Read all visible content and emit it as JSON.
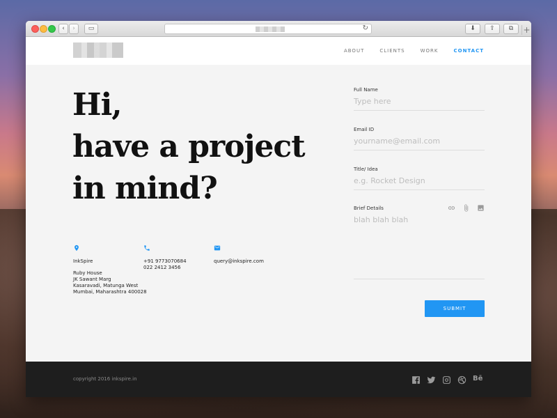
{
  "nav": {
    "about": "ABOUT",
    "clients": "CLIENTS",
    "work": "WORK",
    "contact": "CONTACT"
  },
  "hero": {
    "line1": "Hi,",
    "line2": "have a project",
    "line3": "in mind?"
  },
  "contact": {
    "company": "InkSpire",
    "address_lines": [
      "Ruby House",
      "JK Sawant Marg",
      "Kasaravadi, Matunga West",
      "Mumbai, Maharashtra 400028"
    ],
    "phone1": "+91 9773070684",
    "phone2": "022 2412 3456",
    "email": "query@inkspire.com"
  },
  "form": {
    "full_name_label": "Full Name",
    "full_name_placeholder": "Type here",
    "email_label": "Email ID",
    "email_placeholder": "yourname@email.com",
    "title_label": "Title/ Idea",
    "title_placeholder": "e.g. Rocket Design",
    "details_label": "Brief Details",
    "details_placeholder": "blah blah blah",
    "submit_label": "SUBMIT"
  },
  "footer": {
    "copyright": "copyright 2016 inkspire.in",
    "behance_text": "Bē"
  },
  "colors": {
    "accent": "#2196f3",
    "footer_bg": "#1e1e1e",
    "page_bg": "#f4f4f4"
  },
  "icons": {
    "location": "location-pin-icon",
    "phone": "phone-icon",
    "email": "envelope-icon",
    "link": "link-icon",
    "attach": "paperclip-icon",
    "image": "image-icon",
    "social": [
      "facebook-icon",
      "twitter-icon",
      "instagram-icon",
      "dribbble-icon",
      "behance-icon"
    ]
  }
}
